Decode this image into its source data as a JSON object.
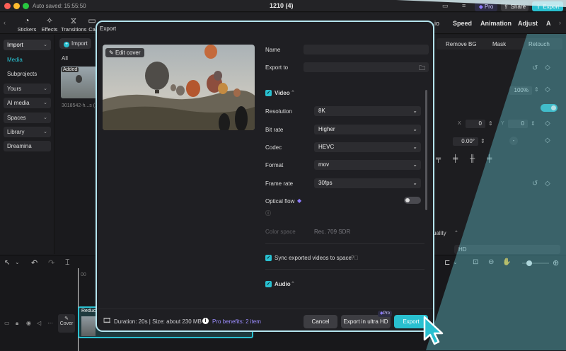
{
  "titlebar": {
    "autosave": "Auto saved: 15:55:50",
    "title": "1210 (4)",
    "pro_label": "Pro",
    "share_label": "Share",
    "export_label": "Export"
  },
  "toolbar": {
    "tools": [
      "Stickers",
      "Effects",
      "Transitions",
      "Ca"
    ],
    "right_tabs": [
      "io",
      "Speed",
      "Animation",
      "Adjust",
      "A"
    ]
  },
  "left_panel": {
    "items": [
      "Import",
      "Media",
      "Subprojects",
      "Yours",
      "AI media",
      "Spaces",
      "Library",
      "Dreamina"
    ]
  },
  "media": {
    "import_label": "Import",
    "filter_label": "All",
    "added_badge": "Added",
    "thumb_caption": "3018542-h...s (1)"
  },
  "right_panel": {
    "subtabs": [
      "Remove BG",
      "Mask",
      "Retouch"
    ],
    "scale_value": "100%",
    "x_label": "X",
    "x_value": "0",
    "y_label": "Y",
    "y_value": "0",
    "rotation_value": "0.00°",
    "quality_label": "uality",
    "hd_label": "HD"
  },
  "dialog": {
    "title": "Export",
    "edit_cover": "Edit cover",
    "name_label": "Name",
    "export_to_label": "Export to",
    "video_section": "Video",
    "resolution_label": "Resolution",
    "resolution_value": "8K",
    "bitrate_label": "Bit rate",
    "bitrate_value": "Higher",
    "codec_label": "Codec",
    "codec_value": "HEVC",
    "format_label": "Format",
    "format_value": "mov",
    "framerate_label": "Frame rate",
    "framerate_value": "30fps",
    "optical_flow_label": "Optical flow",
    "color_space_label": "Color space",
    "color_space_value": "Rec. 709 SDR",
    "sync_label": "Sync exported videos to space",
    "audio_section": "Audio",
    "duration_info": "Duration: 20s | Size: about 230 MB",
    "pro_benefits": "Pro benefits: 2 item",
    "cancel_label": "Cancel",
    "ultra_hd_label": "Export in ultra HD",
    "ultra_pro_badge": "Pro",
    "export_label": "Export"
  },
  "timeline": {
    "time_mark": "00",
    "cover_label": "Cover",
    "clip_label": "Reduc"
  },
  "colors": {
    "accent": "#29c0d0",
    "dialog_border": "#b4e4ee",
    "pro_badge": "#7b6cf0"
  }
}
